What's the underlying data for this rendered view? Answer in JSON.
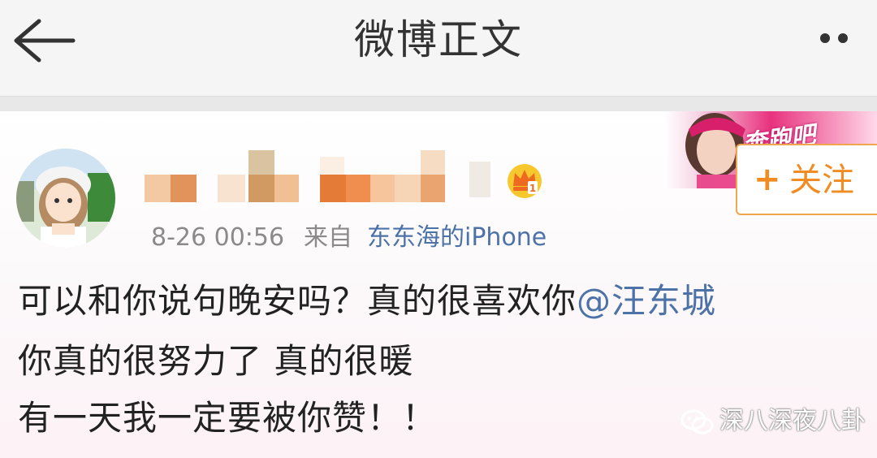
{
  "header": {
    "title": "微博正文",
    "back_icon": "arrow-left-icon",
    "more_icon": "more-dots-icon"
  },
  "post": {
    "author_badge_icon": "crown-icon",
    "timestamp": "8-26 00:56",
    "from_label": "来自",
    "source": "东东海的iPhone",
    "follow_label": "关注",
    "banner_text": "奔跑吧",
    "lines": [
      "可以和你说句晚安吗？真的很喜欢你",
      "你真的很努力了 真的很暖",
      "有一天我一定要被你赞！！"
    ],
    "mention": "@汪东城"
  },
  "watermark": {
    "text": "深八深夜八卦",
    "icon": "wechat-icon"
  },
  "colors": {
    "link": "#4c72a8",
    "follow_orange": "#f08c21",
    "meta_gray": "#8a8a8a"
  }
}
